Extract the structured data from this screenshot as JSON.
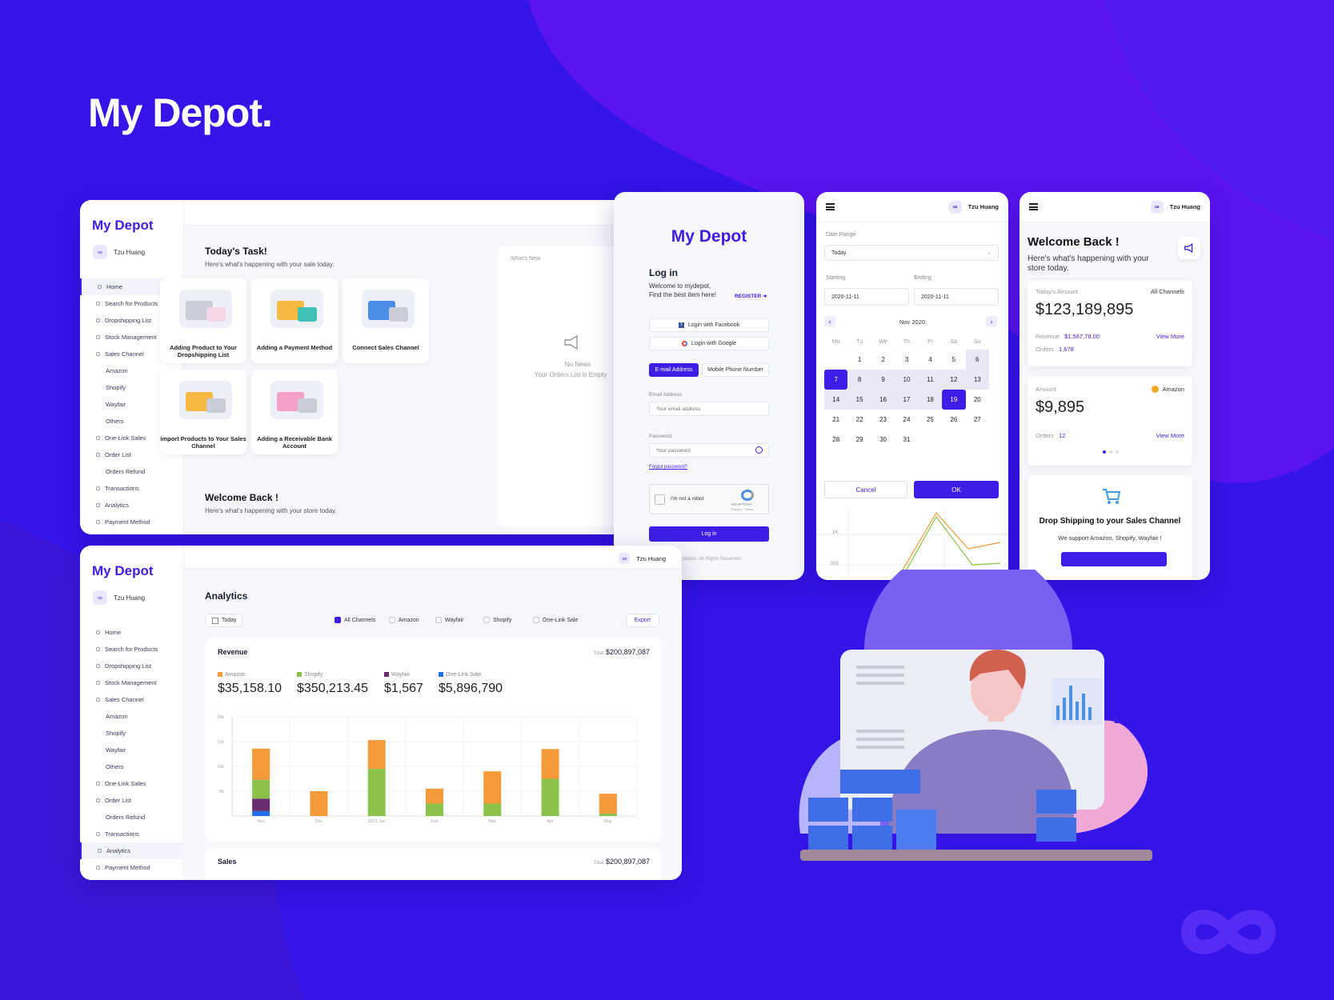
{
  "brand": {
    "title": "My Depot",
    "dot": "."
  },
  "user": {
    "name": "Tzu Huang",
    "avatar": "∞"
  },
  "sidebar": {
    "items": [
      {
        "label": "Home",
        "sub": false
      },
      {
        "label": "Search for Products",
        "sub": false
      },
      {
        "label": "Dropshipping List",
        "sub": false
      },
      {
        "label": "Stock Management",
        "sub": false
      },
      {
        "label": "Sales Channel",
        "sub": false
      },
      {
        "label": "Amazon",
        "sub": true
      },
      {
        "label": "Shopify",
        "sub": true
      },
      {
        "label": "Wayfair",
        "sub": true
      },
      {
        "label": "Others",
        "sub": true
      },
      {
        "label": "One-Link Sales",
        "sub": false
      },
      {
        "label": "Order List",
        "sub": false
      },
      {
        "label": "Orders Refund",
        "sub": true
      },
      {
        "label": "Transactions",
        "sub": false
      },
      {
        "label": "Analytics",
        "sub": false
      },
      {
        "label": "Payment Method",
        "sub": false
      }
    ]
  },
  "dashboard": {
    "task_title": "Today's Task!",
    "task_sub": "Here's what's happening with your sale today.",
    "cards": [
      {
        "label": "Adding Product to Your Dropshipping List"
      },
      {
        "label": "Adding a Payment Method"
      },
      {
        "label": "Connect Sales Channel"
      },
      {
        "label": "Import Products to Your Sales Channel"
      },
      {
        "label": "Adding a Receivable Bank Account"
      }
    ],
    "whats_new": "What's New",
    "no_news": "No News",
    "orders_empty": "Your Orders List is Empty",
    "welcome_title": "Welcome Back !",
    "welcome_sub": "Here's what's happening with your store today."
  },
  "login": {
    "logo": "My Depot",
    "title": "Log in",
    "line1": "Welcome to mydepot,",
    "line2": "Find the best item here!",
    "register": "REGISTER",
    "facebook": "Login with Facebook",
    "google": "Login with Google",
    "tab_email": "E-mail Address",
    "tab_phone": "Mobile Phone Number",
    "email_label": "Email Address",
    "email_placeholder": "Your email address",
    "password_label": "Password",
    "password_placeholder": "Your password",
    "forgot": "Forgot password?",
    "captcha": "I'm not a robot",
    "captcha_brand": "reCAPTCHA",
    "captcha_terms": "Privacy - Terms",
    "login_btn": "Log in",
    "footer": "mydepot. All Rights Reserved."
  },
  "calendar_phone": {
    "date_range_label": "Date Range",
    "date_range_value": "Today",
    "starting_label": "Starting",
    "ending_label": "Ending",
    "starting_value": "2020-11-11",
    "ending_value": "2020-11-11",
    "month": "Nov 2020",
    "weekdays": [
      "Mo",
      "Tu",
      "We",
      "Th",
      "Fr",
      "Sa",
      "Su"
    ],
    "days": [
      "",
      "1",
      "2",
      "3",
      "4",
      "5",
      "6",
      "7",
      "8",
      "9",
      "10",
      "11",
      "12",
      "13",
      "14",
      "15",
      "16",
      "17",
      "18",
      "19",
      "20",
      "21",
      "22",
      "23",
      "24",
      "25",
      "26",
      "27",
      "28",
      "29",
      "30",
      "31",
      "",
      "",
      ""
    ],
    "selected_days": [
      "7",
      "19"
    ],
    "cancel": "Cancel",
    "ok": "OK",
    "chart_ticks": [
      "1K",
      "500"
    ]
  },
  "welcome_phone": {
    "title": "Welcome Back !",
    "sub": "Here's what's happening with your store today.",
    "today_amount_label": "Today's Amount",
    "all_channels": "All Channels",
    "today_amount": "$123,189,895",
    "revenue_label": "Revenue",
    "revenue_value": "$1,567,78.00",
    "orders_label": "Orders",
    "orders_value": "1,678",
    "view_more": "View More",
    "amount_label": "Amount",
    "amazon": "Amazon",
    "amount_value": "$9,895",
    "orders2_value": "12",
    "drop_title": "Drop Shipping to your Sales Channel",
    "drop_sub": "We support Amazon, Shopify, Wayfair !"
  },
  "analytics": {
    "title": "Analytics",
    "date_btn": "Today",
    "filters": [
      "All Channels",
      "Amazon",
      "Wayfair",
      "Shopify",
      "One-Link Sale"
    ],
    "export": "Export",
    "revenue_title": "Revenue",
    "total_label": "Total",
    "revenue_total": "$200,897,087",
    "sales_title": "Sales",
    "sales_total": "$200,897,087",
    "colors": {
      "amazon": "#f59a3a",
      "shopify": "#8bc34a",
      "wayfair": "#6a2c70",
      "onelink": "#1f6fe8"
    }
  },
  "chart_data": {
    "type": "bar",
    "stacked": true,
    "legend": [
      {
        "name": "Amazon",
        "value": "$35,158.10"
      },
      {
        "name": "Shopify",
        "value": "$350,213.45"
      },
      {
        "name": "Wayfair",
        "value": "$1,567"
      },
      {
        "name": "One-Link Sale",
        "value": "$5,896,790"
      }
    ],
    "y_ticks": [
      "20k",
      "15k",
      "10k",
      "5k"
    ],
    "ylim": [
      0,
      20000
    ],
    "categories": [
      "Nov",
      "Dec",
      "2021 Jan",
      "Feb",
      "Mar",
      "Apr",
      "May"
    ],
    "series": [
      {
        "name": "One-Link Sale",
        "values": [
          1000,
          0,
          0,
          0,
          0,
          0,
          0
        ]
      },
      {
        "name": "Wayfair",
        "values": [
          2500,
          0,
          0,
          0,
          0,
          0,
          0
        ]
      },
      {
        "name": "Shopify",
        "values": [
          3800,
          0,
          9500,
          2500,
          2500,
          7500,
          500
        ]
      },
      {
        "name": "Amazon",
        "values": [
          6300,
          5000,
          5800,
          3000,
          6500,
          6000,
          4000
        ]
      }
    ]
  }
}
